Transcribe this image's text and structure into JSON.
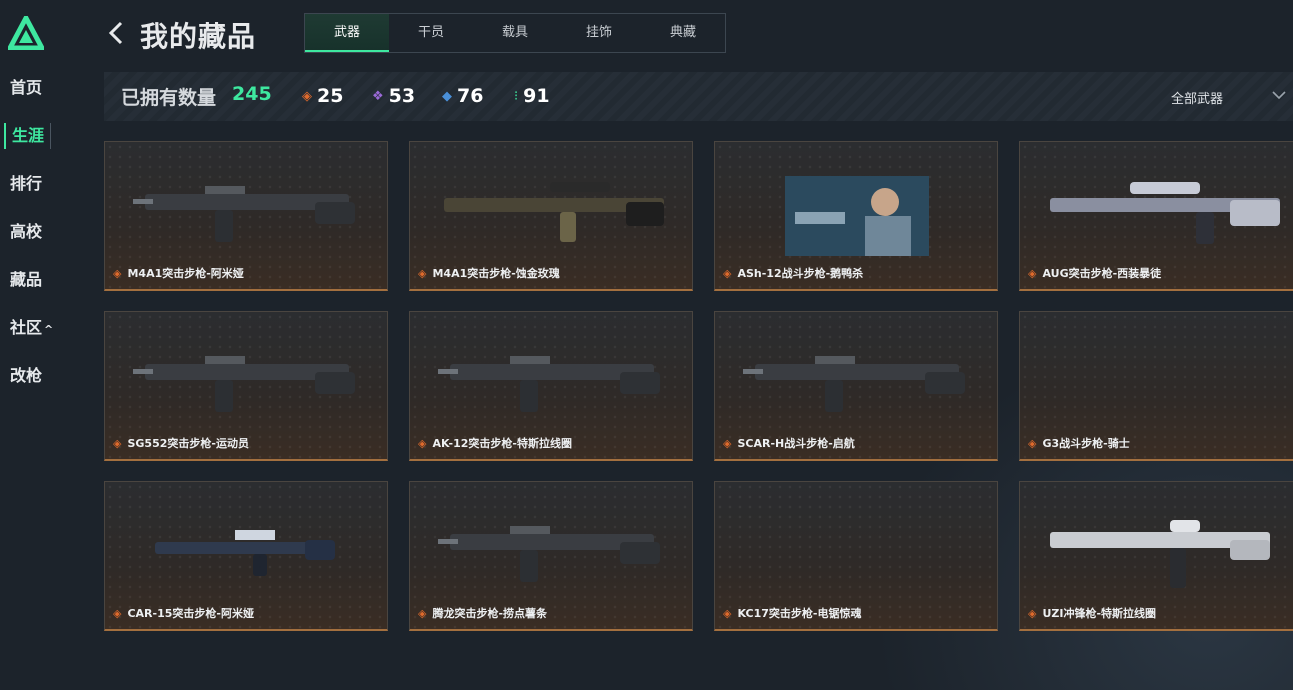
{
  "sidebar": {
    "items": [
      {
        "label": "首页"
      },
      {
        "label": "生涯",
        "active": true
      },
      {
        "label": "排行"
      },
      {
        "label": "高校"
      },
      {
        "label": "藏品"
      },
      {
        "label": "社区",
        "caret": "^"
      },
      {
        "label": "改枪"
      }
    ],
    "logo_icon": "triangle-logo-icon"
  },
  "header": {
    "title": "我的藏品",
    "tabs": [
      {
        "label": "武器",
        "active": true
      },
      {
        "label": "干员"
      },
      {
        "label": "载具"
      },
      {
        "label": "挂饰"
      },
      {
        "label": "典藏"
      }
    ]
  },
  "stats": {
    "owned_label": "已拥有数量",
    "owned_count": "245",
    "rarities": [
      {
        "value": "25",
        "color": "#e06a2c",
        "icon": "orange-gem-icon"
      },
      {
        "value": "53",
        "color": "#9b6ad8",
        "icon": "purple-gem-icon"
      },
      {
        "value": "76",
        "color": "#4a8fd8",
        "icon": "blue-gem-icon"
      },
      {
        "value": "91",
        "color": "#3ee8a0",
        "icon": "green-gem-icon"
      }
    ],
    "filter_label": "全部武器"
  },
  "items": [
    {
      "name": "M4A1突击步枪-阿米娅",
      "art": "rifle"
    },
    {
      "name": "M4A1突击步枪-蚀金玫瑰",
      "art": "sniper"
    },
    {
      "name": "ASh-12战斗步枪-鹅鸭杀",
      "art": "photo"
    },
    {
      "name": "AUG突击步枪-西装暴徒",
      "art": "bullpup"
    },
    {
      "name": "SG552突击步枪-运动员",
      "art": "rifle"
    },
    {
      "name": "AK-12突击步枪-特斯拉线圈",
      "art": "rifle"
    },
    {
      "name": "SCAR-H战斗步枪-启航",
      "art": "rifle"
    },
    {
      "name": "G3战斗步枪-骑士",
      "art": "none"
    },
    {
      "name": "CAR-15突击步枪-阿米娅",
      "art": "smallrifle"
    },
    {
      "name": "腾龙突击步枪-捞点薯条",
      "art": "rifle"
    },
    {
      "name": "KC17突击步枪-电锯惊魂",
      "art": "none"
    },
    {
      "name": "UZI冲锋枪-特斯拉线圈",
      "art": "smg"
    }
  ],
  "colors": {
    "accent": "#3ee8a0",
    "card_border_bottom": "#a4703f",
    "rarity_orange": "#e06a2c"
  }
}
